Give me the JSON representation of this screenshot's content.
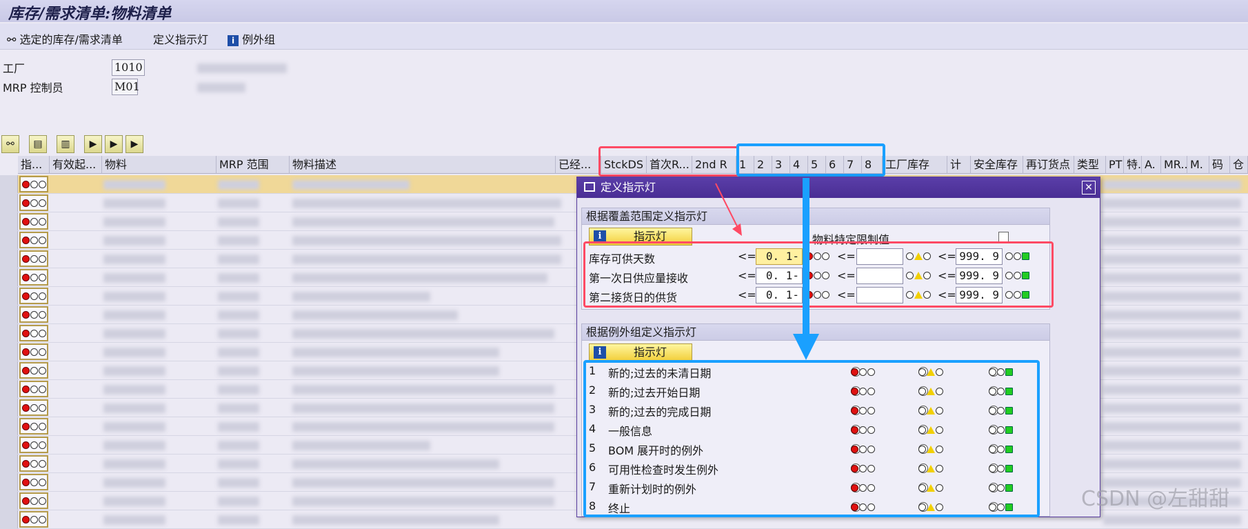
{
  "title": "库存/需求清单:物料清单",
  "toolbar": {
    "selected_list": "选定的库存/需求清单",
    "define_light": "定义指示灯",
    "exception_group": "例外组"
  },
  "header": {
    "plant_label": "工厂",
    "plant_value": "1010",
    "mrp_ctrl_label": "MRP 控制员",
    "mrp_ctrl_value": "M01"
  },
  "columns": [
    "指...",
    "有效起...",
    "物料",
    "MRP 范围",
    "物料描述",
    "已经...",
    "StckDS",
    "首次R...",
    "2nd R",
    "1",
    "2",
    "3",
    "4",
    "5",
    "6",
    "7",
    "8",
    "工厂库存",
    "计",
    "安全库存",
    "再订货点",
    "类型",
    "PT",
    "特.",
    "A.",
    "MR...",
    "M.",
    "码",
    "仓"
  ],
  "dialog": {
    "title": "定义指示灯",
    "coverage_group_title": "根据覆盖范围定义指示灯",
    "light_button": "指示灯",
    "material_limit_label": "物料特定限制值",
    "le": "<=",
    "coverage_rows": [
      {
        "label": "库存可供天数",
        "v1": "0. 1-",
        "v2": "",
        "v3": "999. 9"
      },
      {
        "label": "第一次日供应量接收",
        "v1": "0. 1-",
        "v2": "",
        "v3": "999. 9"
      },
      {
        "label": "第二接货日的供货",
        "v1": "0. 1-",
        "v2": "",
        "v3": "999. 9"
      }
    ],
    "exception_group_title": "根据例外组定义指示灯",
    "exception_rows": [
      {
        "num": "1",
        "label": "新的;过去的未清日期",
        "selected": "green"
      },
      {
        "num": "2",
        "label": "新的;过去开始日期",
        "selected": "green"
      },
      {
        "num": "3",
        "label": "新的;过去的完成日期",
        "selected": "green"
      },
      {
        "num": "4",
        "label": "一般信息",
        "selected": "green"
      },
      {
        "num": "5",
        "label": "BOM 展开时的例外",
        "selected": "green"
      },
      {
        "num": "6",
        "label": "可用性检查时发生例外",
        "selected": "green"
      },
      {
        "num": "7",
        "label": "重新计划时的例外",
        "selected": "green"
      },
      {
        "num": "8",
        "label": "终止",
        "selected": "red"
      }
    ]
  },
  "watermark": "CSDN @左甜甜"
}
